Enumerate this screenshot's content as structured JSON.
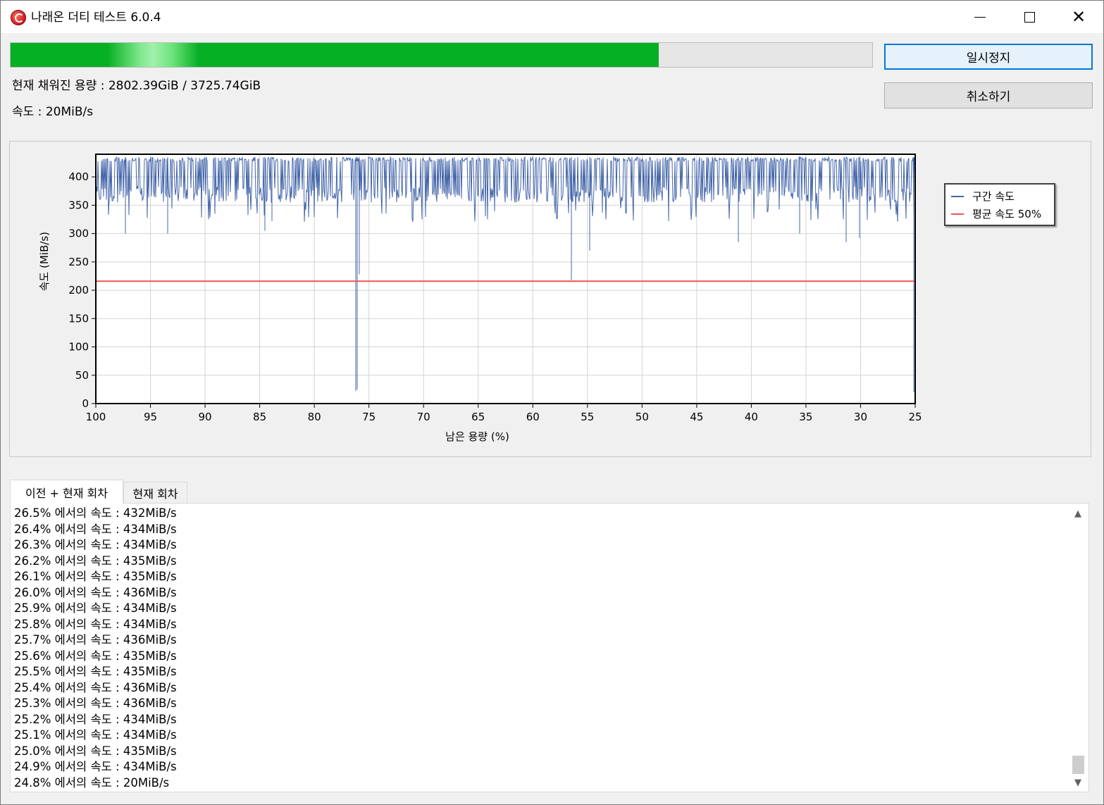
{
  "window": {
    "title": "나래온 더티 테스트 6.0.4"
  },
  "progress": {
    "fraction": 0.7522
  },
  "status": {
    "fill_label": "현재 채워진 용량 : 2802.39GiB / 3725.74GiB",
    "speed_label": "속도 : 20MiB/s"
  },
  "buttons": {
    "pause": "일시정지",
    "cancel": "취소하기"
  },
  "chart_data": {
    "type": "line",
    "xlabel": "남은 용량 (%)",
    "ylabel": "속도 (MiB/s)",
    "xlim": [
      100,
      25
    ],
    "ylim": [
      0,
      440
    ],
    "x_ticks": [
      100,
      95,
      90,
      85,
      80,
      75,
      70,
      65,
      60,
      55,
      50,
      45,
      40,
      35,
      30,
      25
    ],
    "y_ticks": [
      0,
      50,
      100,
      150,
      200,
      250,
      300,
      350,
      400
    ],
    "grid": true,
    "legend_position": "right",
    "series": [
      {
        "name": "구간 속도",
        "color": "#4466aa",
        "baseline_range": [
          355,
          435
        ],
        "dips": [
          {
            "x": 97.3,
            "y": 300
          },
          {
            "x": 93.4,
            "y": 300
          },
          {
            "x": 84.5,
            "y": 305
          },
          {
            "x": 83.9,
            "y": 322
          },
          {
            "x": 76.2,
            "y": 22
          },
          {
            "x": 76.1,
            "y": 25
          },
          {
            "x": 75.9,
            "y": 228
          },
          {
            "x": 56.5,
            "y": 218
          },
          {
            "x": 54.8,
            "y": 270
          },
          {
            "x": 41.2,
            "y": 285
          },
          {
            "x": 35.6,
            "y": 300
          },
          {
            "x": 31.3,
            "y": 285
          },
          {
            "x": 30.1,
            "y": 292
          },
          {
            "x": 25.1,
            "y": 20
          }
        ],
        "last_value": 20
      },
      {
        "name": "평균 속도 50%",
        "color": "#ee5555",
        "constant": 216
      }
    ]
  },
  "tabs": {
    "all": "이전 + 현재 회차",
    "current": "현재 회차"
  },
  "log": [
    "26.5% 에서의 속도 : 432MiB/s",
    "26.4% 에서의 속도 : 434MiB/s",
    "26.3% 에서의 속도 : 434MiB/s",
    "26.2% 에서의 속도 : 435MiB/s",
    "26.1% 에서의 속도 : 435MiB/s",
    "26.0% 에서의 속도 : 436MiB/s",
    "25.9% 에서의 속도 : 434MiB/s",
    "25.8% 에서의 속도 : 434MiB/s",
    "25.7% 에서의 속도 : 436MiB/s",
    "25.6% 에서의 속도 : 435MiB/s",
    "25.5% 에서의 속도 : 435MiB/s",
    "25.4% 에서의 속도 : 436MiB/s",
    "25.3% 에서의 속도 : 436MiB/s",
    "25.2% 에서의 속도 : 434MiB/s",
    "25.1% 에서의 속도 : 434MiB/s",
    "25.0% 에서의 속도 : 435MiB/s",
    "24.9% 에서의 속도 : 434MiB/s",
    "24.8% 에서의 속도 : 20MiB/s"
  ]
}
